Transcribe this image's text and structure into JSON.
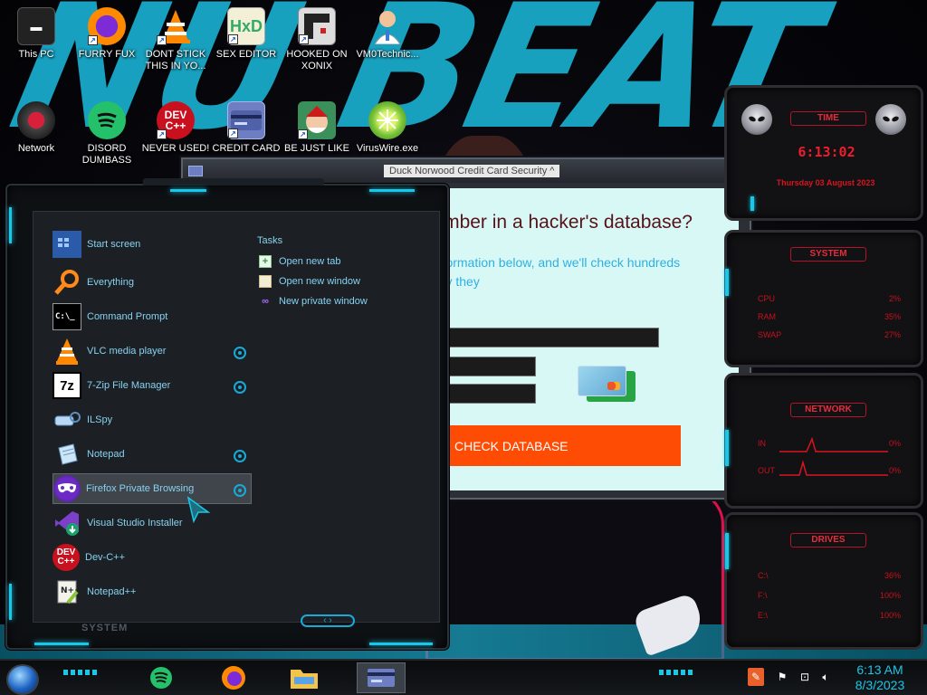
{
  "desktop": {
    "icons": [
      {
        "label": "This PC"
      },
      {
        "label": "FURRY FUX"
      },
      {
        "label": "DONT STICK THIS IN YO..."
      },
      {
        "label": "SEX EDITOR"
      },
      {
        "label": "HOOKED ON XONIX"
      },
      {
        "label": "VM0Technic..."
      },
      {
        "label": "Network"
      },
      {
        "label": "DISORD DUMBASS"
      },
      {
        "label": "NEVER USED!"
      },
      {
        "label": "CREDIT CARD"
      },
      {
        "label": "BE JUST LIKE"
      },
      {
        "label": "VirusWire.exe"
      }
    ]
  },
  "browser": {
    "tab_title": "Duck Norwood Credit Card Security ^",
    "heading": "Is your credit card number in a hacker's database?",
    "lead": "All you need to do is enter its information below, and we'll check hundreds of hacker databases to see if any they",
    "submit_label": "CHECK DATABASE"
  },
  "start_menu": {
    "items": [
      {
        "label": "Start screen",
        "icon": "start-screen-icon"
      },
      {
        "label": "Everything",
        "icon": "magnifier-icon"
      },
      {
        "label": "Command Prompt",
        "icon": "terminal-icon"
      },
      {
        "label": "VLC media player",
        "icon": "vlc-cone-icon"
      },
      {
        "label": "7-Zip File Manager",
        "icon": "7zip-icon"
      },
      {
        "label": "ILSpy",
        "icon": "ilspy-icon"
      },
      {
        "label": "Notepad",
        "icon": "notepad-icon"
      },
      {
        "label": "Firefox Private Browsing",
        "icon": "firefox-private-icon"
      },
      {
        "label": "Visual Studio Installer",
        "icon": "visual-studio-icon"
      },
      {
        "label": "Dev-C++",
        "icon": "devcpp-icon"
      },
      {
        "label": "Notepad++",
        "icon": "notepadpp-icon"
      }
    ],
    "tasks_title": "Tasks",
    "tasks": [
      {
        "label": "Open new tab",
        "icon": "plus-icon"
      },
      {
        "label": "Open new window",
        "icon": "window-icon"
      },
      {
        "label": "New private window",
        "icon": "mask-icon"
      }
    ],
    "footer": "SYSTEM"
  },
  "gadgets": {
    "clock": {
      "title": "TIME",
      "time": "6:13:02",
      "date": "Thursday 03 August 2023"
    },
    "system": {
      "title": "SYSTEM",
      "rows": [
        {
          "label": "CPU",
          "value": "2%"
        },
        {
          "label": "RAM",
          "value": "35%"
        },
        {
          "label": "SWAP",
          "value": "27%"
        }
      ]
    },
    "network": {
      "title": "NETWORK",
      "rows": [
        {
          "label": "IN",
          "value": "0%"
        },
        {
          "label": "OUT",
          "value": "0%"
        }
      ]
    },
    "drives": {
      "title": "DRIVES",
      "rows": [
        {
          "label": "C:\\",
          "value": "36%"
        },
        {
          "label": "F:\\",
          "value": "100%"
        },
        {
          "label": "E:\\",
          "value": "100%"
        }
      ]
    }
  },
  "taskbar": {
    "time": "6:13 AM",
    "date": "8/3/2023"
  },
  "colors": {
    "accent": "#19c7e8",
    "gadget_red": "#e72c3c",
    "submit": "#ff4c05"
  }
}
